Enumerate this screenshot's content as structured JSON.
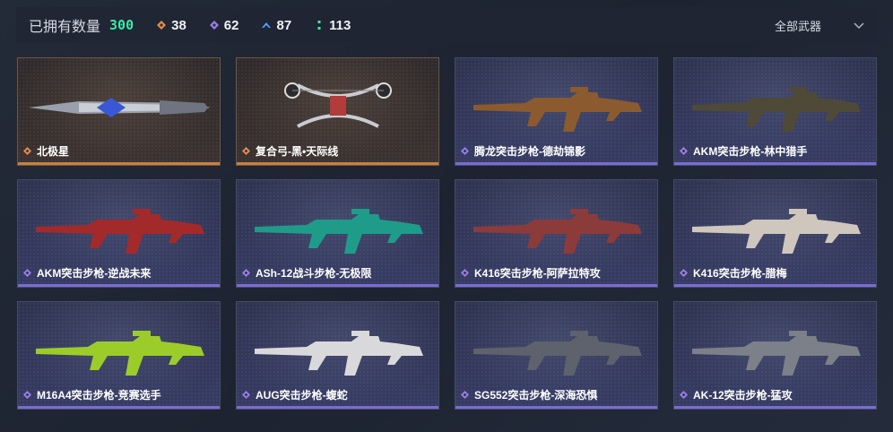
{
  "header": {
    "owned_label": "已拥有数量",
    "owned_count": "300",
    "rarities": [
      {
        "icon": "orange-diamond-icon",
        "color": "#e48b4a",
        "count": "38"
      },
      {
        "icon": "purple-diamond-icon",
        "color": "#9b7ce8",
        "count": "62"
      },
      {
        "icon": "blue-chevron-icon",
        "color": "#4da3ff",
        "count": "87"
      },
      {
        "icon": "teal-dots-icon",
        "color": "#3fe7a3",
        "count": "113"
      }
    ],
    "filter": {
      "selected": "全部武器"
    }
  },
  "weapons": [
    {
      "name": "北极星",
      "rarity": "gold",
      "icon": "dagger-icon"
    },
    {
      "name": "复合弓-黑•天际线",
      "rarity": "gold",
      "icon": "compound-bow-icon"
    },
    {
      "name": "腾龙突击步枪-德劫锦影",
      "rarity": "purple",
      "icon": "assault-rifle-icon"
    },
    {
      "name": "AKM突击步枪-林中猎手",
      "rarity": "purple",
      "icon": "assault-rifle-icon"
    },
    {
      "name": "AKM突击步枪-逆战未来",
      "rarity": "purple",
      "icon": "assault-rifle-icon"
    },
    {
      "name": "ASh-12战斗步枪-无极限",
      "rarity": "purple",
      "icon": "battle-rifle-icon"
    },
    {
      "name": "K416突击步枪-阿萨拉特攻",
      "rarity": "purple",
      "icon": "assault-rifle-icon"
    },
    {
      "name": "K416突击步枪-腊梅",
      "rarity": "purple",
      "icon": "assault-rifle-icon"
    },
    {
      "name": "M16A4突击步枪-竞赛选手",
      "rarity": "purple",
      "icon": "assault-rifle-icon"
    },
    {
      "name": "AUG突击步枪-蝮蛇",
      "rarity": "purple",
      "icon": "bullpup-rifle-icon"
    },
    {
      "name": "SG552突击步枪-深海恐惧",
      "rarity": "purple",
      "icon": "assault-rifle-icon"
    },
    {
      "name": "AK-12突击步枪-猛攻",
      "rarity": "purple",
      "icon": "assault-rifle-icon"
    }
  ]
}
